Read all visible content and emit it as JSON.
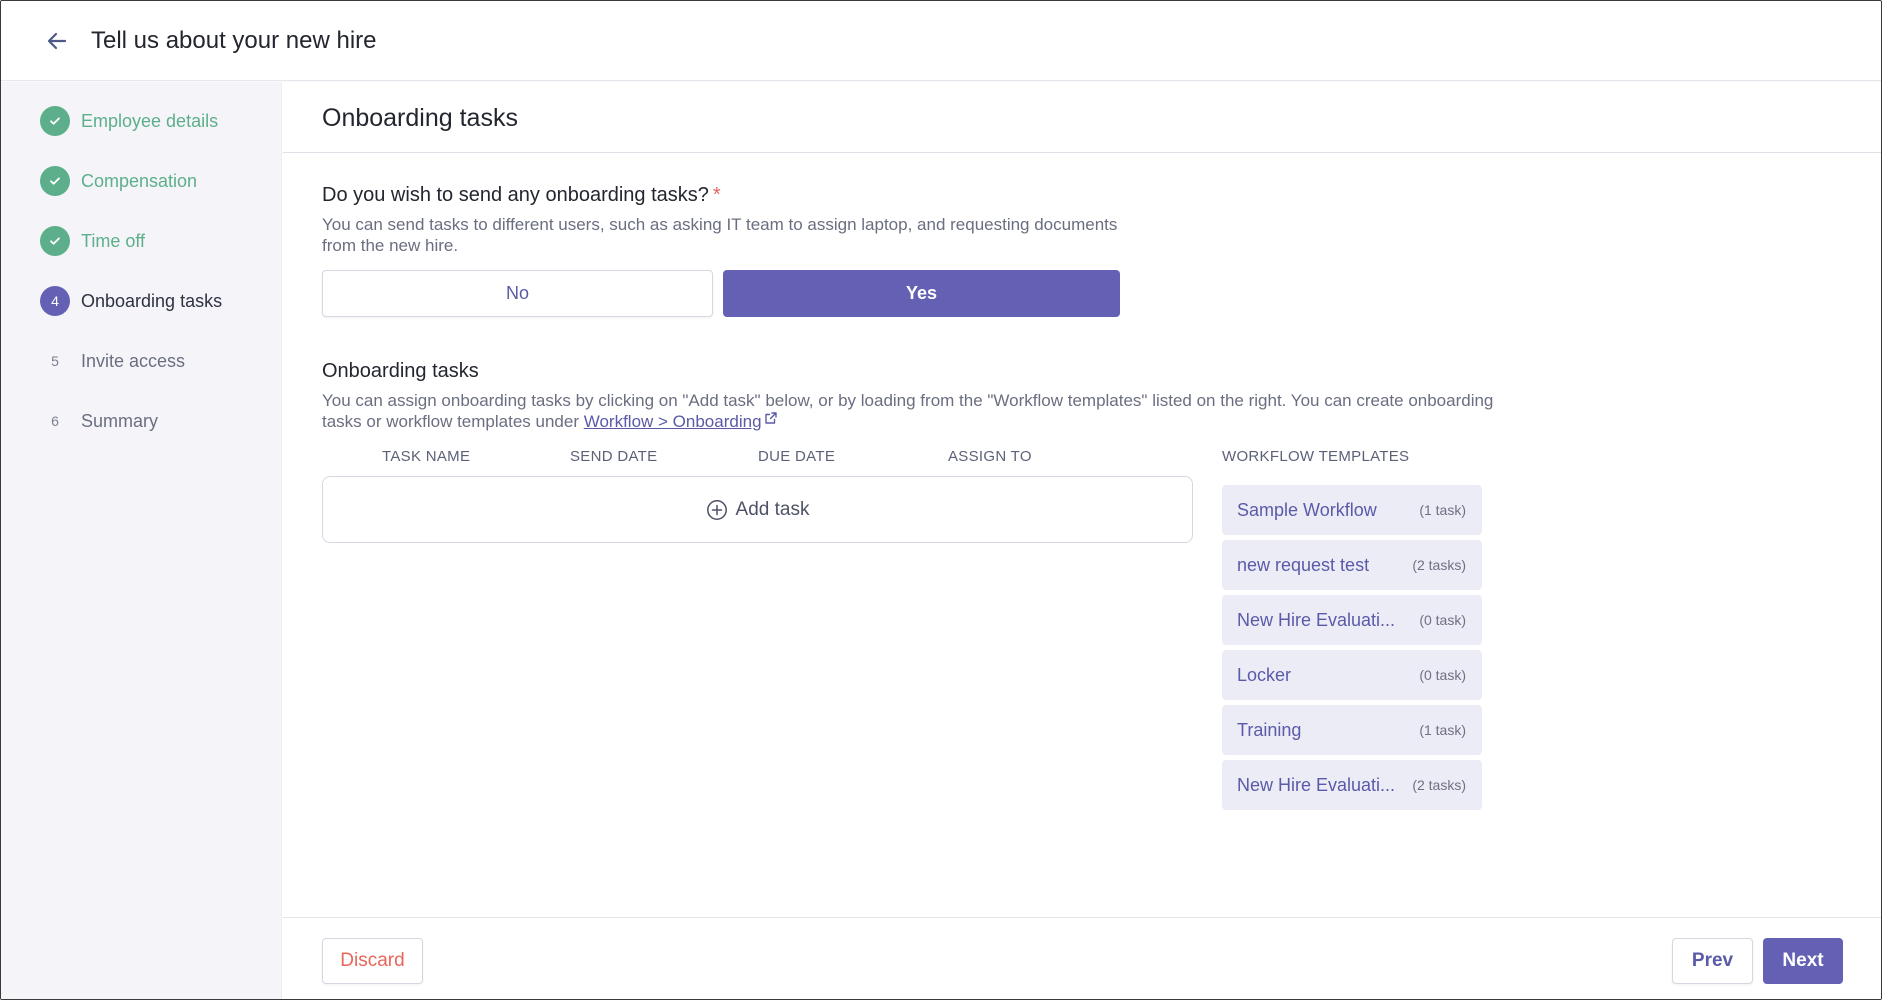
{
  "header": {
    "title": "Tell us about your new hire",
    "back_icon": "arrow-left-icon"
  },
  "steps": [
    {
      "number": "1",
      "label": "Employee details",
      "status": "done"
    },
    {
      "number": "2",
      "label": "Compensation",
      "status": "done"
    },
    {
      "number": "3",
      "label": "Time off",
      "status": "done"
    },
    {
      "number": "4",
      "label": "Onboarding tasks",
      "status": "active"
    },
    {
      "number": "5",
      "label": "Invite access",
      "status": "todo"
    },
    {
      "number": "6",
      "label": "Summary",
      "status": "todo"
    }
  ],
  "main": {
    "section_title": "Onboarding tasks",
    "question": {
      "title": "Do you wish to send any onboarding tasks?",
      "required_mark": "*",
      "description": "You can send tasks to different users, such as asking IT team to assign laptop, and requesting documents from the new hire.",
      "options": {
        "no": "No",
        "yes": "Yes"
      },
      "selected": "Yes"
    },
    "onboarding": {
      "title": "Onboarding tasks",
      "description_prefix": "You can assign onboarding tasks by clicking on \"Add task\" below, or by loading from the \"Workflow templates\" listed on the right. You can create onboarding tasks or workflow templates under ",
      "link_text": "Workflow > Onboarding",
      "columns": [
        "TASK NAME",
        "SEND DATE",
        "DUE DATE",
        "ASSIGN TO"
      ],
      "add_task_label": "Add task"
    },
    "workflow_templates": {
      "header": "WORKFLOW TEMPLATES",
      "items": [
        {
          "name": "Sample Workflow",
          "count": "(1 task)"
        },
        {
          "name": "new request test",
          "count": "(2 tasks)"
        },
        {
          "name": "New Hire Evaluati...",
          "count": "(0 task)"
        },
        {
          "name": "Locker",
          "count": "(0 task)"
        },
        {
          "name": "Training",
          "count": "(1 task)"
        },
        {
          "name": "New Hire Evaluati...",
          "count": "(2 tasks)"
        }
      ]
    }
  },
  "footer": {
    "discard": "Discard",
    "prev": "Prev",
    "next": "Next"
  },
  "colors": {
    "accent": "#6461b4",
    "done": "#5caf8a",
    "danger": "#e8665b",
    "template_bg": "#ececf7"
  }
}
